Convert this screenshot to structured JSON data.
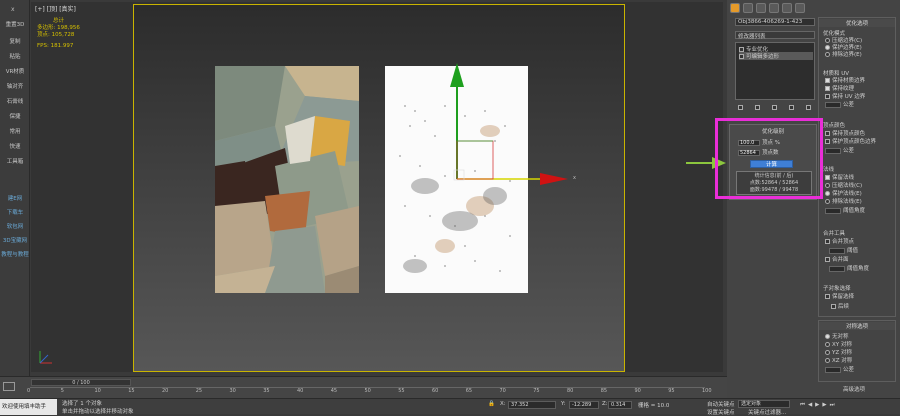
{
  "left_toolbar": {
    "close": "x",
    "items": [
      "重置3D",
      "复制",
      "粘贴",
      "VR材质",
      "轴对齐",
      "石膏线",
      "保捷",
      "常用",
      "快速",
      "工具箱"
    ],
    "blue_items": [
      "建E网",
      "下载车",
      "软包网",
      "3D宝藏网",
      "教程与教程"
    ]
  },
  "viewport": {
    "label": "[+] [顶] [真实]",
    "stats": {
      "total_label": "总计",
      "poly_label": "多边形:",
      "poly_value": "198,956",
      "vert_label": "顶点:",
      "vert_value": "105,728",
      "fps_label": "FPS:",
      "fps_value": "181.997"
    },
    "axis_x": "x",
    "axis_y": "y",
    "axis_z": "z"
  },
  "right_panel": {
    "object_name": "Obj3866-406269-1-423",
    "modifier_list": "修改器列表",
    "stack_items": [
      "专业优化",
      "可编辑多边形"
    ],
    "opt": {
      "title": "优化选项",
      "mode_title": "优化模式",
      "mode_items": [
        "压缩边界(C)",
        "保护边界(E)",
        "排除边界(E)"
      ],
      "uv_title": "材质和 UV",
      "uv_items": [
        "保持材质边界",
        "保持纹理",
        "保持 UV 边界"
      ],
      "uv_tol": "公差",
      "vcolor_title": "顶点颜色",
      "vcolor_items": [
        "保持顶点颜色",
        "保护顶点颜色边界"
      ],
      "vcolor_tol": "公差",
      "normals_title": "法线",
      "normals_items": [
        "保留法线",
        "压缩法线(C)",
        "保护法线(E)",
        "排除法线(E)"
      ],
      "normals_angle": "阈值角度",
      "merge_title": "合并工具",
      "merge_items": [
        "合并顶点",
        "阈值",
        "合并面",
        "阈值角度"
      ],
      "subobj_title": "子对象选择",
      "subobj_items": [
        "保留选择",
        "后续"
      ]
    },
    "sym": {
      "title": "对称选项",
      "items": [
        "无对称",
        "XY 对称",
        "YZ 对称",
        "XZ 对称"
      ],
      "tol": "公差",
      "more": "高级选项"
    }
  },
  "opt_dialog": {
    "title": "优化级别",
    "vertex_pct_value": "100.0",
    "vertex_pct_label": "顶点 %",
    "vertex_count_value": "52864",
    "vertex_count_label": "顶点数",
    "calc_button": "计算",
    "stats_title": "统计信息(前 / 后)",
    "stats_points": "点数:52864 / 52864",
    "stats_faces": "面数:99478 / 99478"
  },
  "timeline": {
    "frame": "0 / 100",
    "ticks": [
      "0",
      "5",
      "10",
      "15",
      "20",
      "25",
      "30",
      "35",
      "40",
      "45",
      "50",
      "55",
      "60",
      "65",
      "70",
      "75",
      "80",
      "85",
      "90",
      "95",
      "100"
    ]
  },
  "status": {
    "selected": "选择了 1 个对象",
    "hint": "单击并拖动以选择并移动对象",
    "welcome": "欢迎使用填丰助手",
    "x_label": "X:",
    "x_value": "37.352",
    "y_label": "Y:",
    "y_value": "-12.289",
    "z_label": "Z:",
    "z_value": "0.314",
    "grid_label": "栅格 = 10.0",
    "autokey": "自动关键点",
    "selected_object": "选定对象",
    "setkey": "设置关键点",
    "keyfilter": "关键点过滤器..."
  },
  "colors": {
    "highlight": "#ea2ed8",
    "accent": "#3f7fd6",
    "viewport_border": "#c9b400",
    "tab_active": "#e59a2a"
  }
}
